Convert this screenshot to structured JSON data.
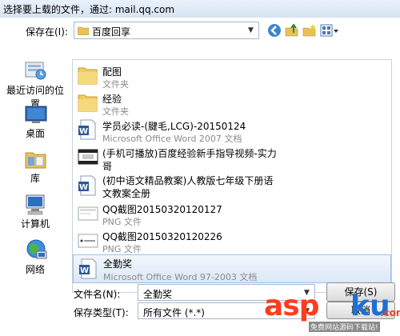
{
  "window": {
    "title": "选择要上载的文件，通过: mail.qq.com"
  },
  "toolbar": {
    "save_in_label": "保存在(I):",
    "location": "百度回享",
    "icons": [
      "back-icon",
      "up-folder-icon",
      "new-folder-icon",
      "view-menu-icon"
    ]
  },
  "places": [
    {
      "label": "最近访问的位置",
      "icon": "recent-places-icon"
    },
    {
      "label": "桌面",
      "icon": "desktop-icon"
    },
    {
      "label": "库",
      "icon": "libraries-icon"
    },
    {
      "label": "计算机",
      "icon": "computer-icon"
    },
    {
      "label": "网络",
      "icon": "network-icon"
    }
  ],
  "files": [
    {
      "name": "配图",
      "type": "文件夹",
      "icon": "folder-icon"
    },
    {
      "name": "经验",
      "type": "文件夹",
      "icon": "folder-icon"
    },
    {
      "name": "学员必读-(腱毛,LCG)-20150124",
      "type": "Microsoft Office Word 2007 文档",
      "icon": "word-doc-icon"
    },
    {
      "name": "(手机可播放)百度经验新手指导视频-实力",
      "name2": "哥",
      "icon": "video-file-icon"
    },
    {
      "name": "(初中语文精品教案)人教版七年级下册语",
      "name2": "文教案全册",
      "icon": "word-doc-icon"
    },
    {
      "name": "QQ截图20150320120127",
      "type": "PNG 文件",
      "icon": "png-file-icon"
    },
    {
      "name": "QQ截图20150320120226",
      "type": "PNG 文件",
      "icon": "png-file-icon"
    },
    {
      "name": "全勤奖",
      "type": "Microsoft Office Word 97-2003 文档",
      "icon": "word-doc-icon",
      "selected": true
    }
  ],
  "bottom": {
    "filename_label": "文件名(N):",
    "filename_value": "全勤奖",
    "filetype_label": "保存类型(T):",
    "filetype_value": "所有文件 (*.*)",
    "open_button": "保存(S)",
    "cancel_button": "取消"
  },
  "watermark": {
    "main_a": "asp",
    "main_b": "ku",
    "suffix": ".com",
    "sub": "免费网站源码下载站!"
  },
  "colors": {
    "selection": "#dbe8f7",
    "title_bg": "#d7e4f2",
    "watermark_red": "#ff3c1e",
    "watermark_blue": "#1e6fd2"
  }
}
